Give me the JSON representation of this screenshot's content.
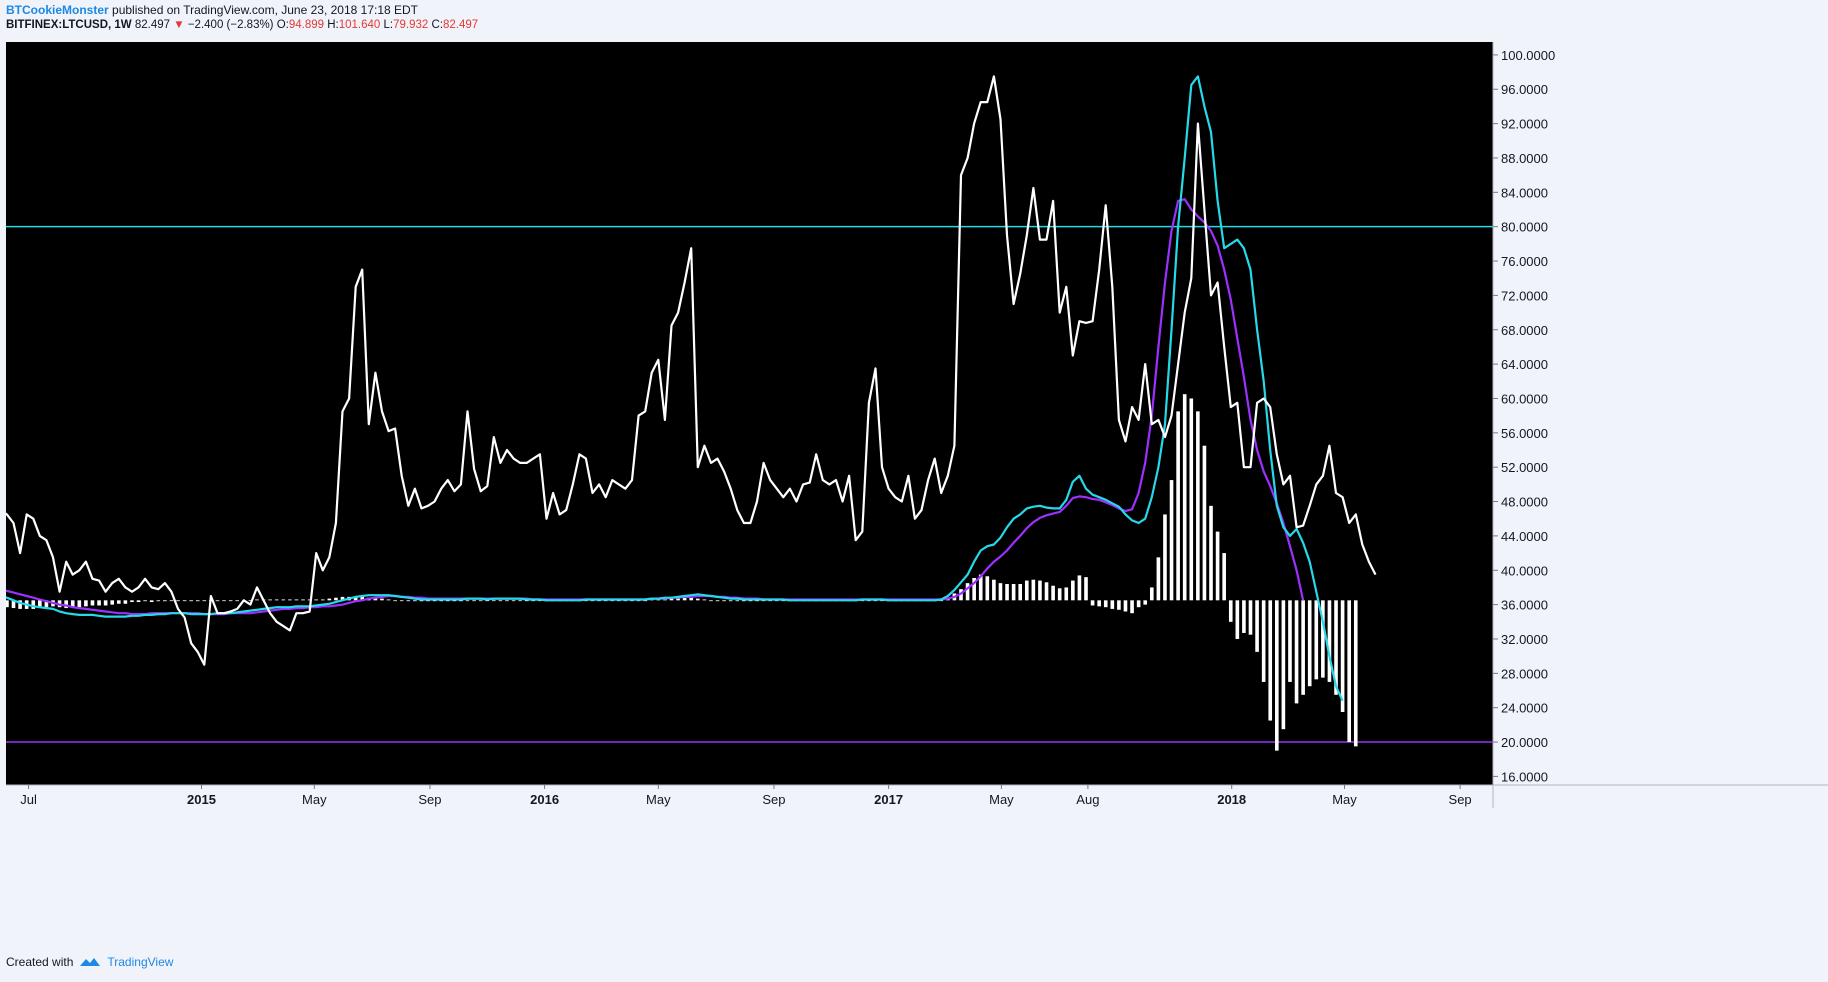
{
  "header": {
    "author": "BTCookieMonster",
    "published": "published on TradingView.com, June 23, 2018 17:18 EDT",
    "symbol": "BITFINEX:LTCUSD, 1W",
    "last": "82.497",
    "change": "−2.400 (−2.83%)",
    "o_label": "O:",
    "o": "94.899",
    "h_label": "H:",
    "h": "101.640",
    "l_label": "L:",
    "l": "79.932",
    "c_label": "C:",
    "c": "82.497",
    "down_arrow": "▼"
  },
  "footer": {
    "created": "Created with",
    "brand": "TradingView"
  },
  "colors": {
    "background": "#000000",
    "oscillator": "#ffffff",
    "fast_line": "#26d9e8",
    "slow_line": "#9b30ff",
    "upper_level": "#26d9e8",
    "lower_level": "#9b30ff",
    "histogram": "#ffffff",
    "axis_text": "#131722"
  },
  "chart_data": {
    "type": "line",
    "ylim": [
      15,
      101.5
    ],
    "xlim": [
      "2014-06-07",
      "2018-10-06"
    ],
    "y_ticks": [
      "100.0000",
      "96.0000",
      "92.0000",
      "88.0000",
      "84.0000",
      "80.0000",
      "76.0000",
      "72.0000",
      "68.0000",
      "64.0000",
      "60.0000",
      "56.0000",
      "52.0000",
      "48.0000",
      "44.0000",
      "40.0000",
      "36.0000",
      "32.0000",
      "28.0000",
      "24.0000",
      "20.0000",
      "16.0000"
    ],
    "x_ticks": [
      {
        "label": "Jul",
        "date": "2014-07-01",
        "bold": false
      },
      {
        "label": "2015",
        "date": "2015-01-01",
        "bold": true
      },
      {
        "label": "May",
        "date": "2015-05-01",
        "bold": false
      },
      {
        "label": "Sep",
        "date": "2015-09-01",
        "bold": false
      },
      {
        "label": "2016",
        "date": "2016-01-01",
        "bold": true
      },
      {
        "label": "May",
        "date": "2016-05-01",
        "bold": false
      },
      {
        "label": "Sep",
        "date": "2016-09-01",
        "bold": false
      },
      {
        "label": "2017",
        "date": "2017-01-01",
        "bold": true
      },
      {
        "label": "May",
        "date": "2017-05-01",
        "bold": false
      },
      {
        "label": "Aug",
        "date": "2017-08-01",
        "bold": false
      },
      {
        "label": "2018",
        "date": "2018-01-01",
        "bold": true
      },
      {
        "label": "May",
        "date": "2018-05-01",
        "bold": false
      },
      {
        "label": "Sep",
        "date": "2018-09-01",
        "bold": false
      }
    ],
    "horizontal_levels": [
      {
        "value": 80
      },
      {
        "value": 20
      }
    ],
    "histogram_baseline": 36.5,
    "series": [
      {
        "key": "oscillator",
        "start": "2014-06-01",
        "step_days": 7,
        "values": [
          47,
          46.5,
          45.5,
          42,
          46.5,
          46,
          44,
          43.5,
          41.5,
          37.5,
          41,
          39.5,
          40,
          41,
          39,
          38.8,
          37.5,
          38.5,
          39,
          38,
          37.5,
          38,
          39,
          38,
          37.8,
          38.5,
          37.5,
          35.5,
          34.5,
          31.5,
          30.5,
          29,
          37,
          35,
          35,
          35.2,
          35.5,
          36.5,
          36,
          38,
          36.5,
          35,
          34,
          33.5,
          33,
          35,
          35,
          35.2,
          42,
          40,
          41.5,
          45.5,
          58.5,
          60,
          73,
          75,
          57,
          63,
          58.5,
          56.2,
          56.5,
          51,
          47.5,
          49.5,
          47.2,
          47.5,
          48,
          49.5,
          50.5,
          49.2,
          50,
          58.5,
          51.8,
          49.2,
          49.8,
          55.5,
          52.5,
          54,
          53,
          52.5,
          52.5,
          53,
          53.5,
          46,
          49,
          46.5,
          47,
          50,
          53.5,
          53,
          49,
          50,
          48.5,
          50.5,
          50,
          49.5,
          50.5,
          58,
          58.5,
          63,
          64.5,
          57.5,
          68.5,
          70,
          73.5,
          77.5,
          52,
          54.5,
          52.5,
          53,
          51.5,
          49.5,
          47,
          45.5,
          45.5,
          48,
          52.5,
          50.5,
          49.5,
          48.5,
          49.5,
          48,
          50,
          50.2,
          53.5,
          50.5,
          50,
          50.5,
          48,
          51,
          43.5,
          44.5,
          59.5,
          63.5,
          52,
          49.5,
          48.5,
          48,
          51,
          46,
          47,
          50.5,
          53,
          49,
          51,
          54.5,
          86,
          88,
          92,
          94.5,
          94.5,
          97.5,
          92.5,
          79,
          71,
          74.5,
          79,
          84.5,
          78.5,
          78.5,
          83,
          70,
          73,
          65,
          69,
          68.8,
          69,
          75,
          82.5,
          73,
          57.5,
          55,
          59,
          57.5,
          64,
          57,
          57.5,
          55.5,
          58,
          64,
          70,
          74,
          92,
          82,
          72,
          73.5,
          66,
          59,
          59.5,
          52,
          52,
          59.5,
          60,
          59,
          53.5,
          50,
          51,
          45,
          45.2,
          47.5,
          50,
          51,
          54.5,
          49,
          48.5,
          45.5,
          46.5,
          43,
          41,
          39.5
        ]
      },
      {
        "key": "fast_line",
        "start": "2014-06-01",
        "step_days": 7,
        "values": [
          37,
          36.8,
          36.5,
          36.2,
          36,
          35.8,
          35.7,
          35.6,
          35.5,
          35.2,
          35,
          34.9,
          34.8,
          34.8,
          34.8,
          34.7,
          34.6,
          34.6,
          34.6,
          34.6,
          34.7,
          34.7,
          34.8,
          34.8,
          34.9,
          34.9,
          35,
          35,
          35,
          34.9,
          34.9,
          34.9,
          34.9,
          35,
          35,
          35,
          35.1,
          35.2,
          35.3,
          35.4,
          35.5,
          35.6,
          35.7,
          35.7,
          35.7,
          35.8,
          35.8,
          35.8,
          35.9,
          36,
          36.1,
          36.3,
          36.5,
          36.7,
          36.9,
          37,
          37.1,
          37.1,
          37.1,
          37.1,
          37,
          36.9,
          36.8,
          36.7,
          36.6,
          36.6,
          36.6,
          36.6,
          36.6,
          36.6,
          36.6,
          36.7,
          36.7,
          36.7,
          36.6,
          36.7,
          36.7,
          36.7,
          36.7,
          36.7,
          36.6,
          36.6,
          36.6,
          36.5,
          36.5,
          36.5,
          36.5,
          36.5,
          36.5,
          36.6,
          36.6,
          36.6,
          36.6,
          36.6,
          36.6,
          36.6,
          36.6,
          36.6,
          36.6,
          36.7,
          36.7,
          36.8,
          36.8,
          36.9,
          37,
          37.1,
          37.2,
          37.1,
          37,
          36.9,
          36.8,
          36.7,
          36.7,
          36.6,
          36.6,
          36.6,
          36.6,
          36.6,
          36.6,
          36.6,
          36.5,
          36.5,
          36.5,
          36.5,
          36.5,
          36.5,
          36.5,
          36.5,
          36.5,
          36.5,
          36.5,
          36.6,
          36.6,
          36.6,
          36.6,
          36.5,
          36.5,
          36.5,
          36.5,
          36.5,
          36.5,
          36.5,
          36.5,
          36.6,
          37,
          37.7,
          38.6,
          39.5,
          41,
          42.3,
          42.8,
          43,
          43.8,
          45,
          46,
          46.5,
          47.2,
          47.4,
          47.5,
          47.3,
          47.2,
          47.2,
          48.2,
          50.3,
          51,
          49.5,
          48.8,
          48.5,
          48.2,
          47.8,
          47.4,
          46.5,
          45.8,
          45.5,
          46,
          48.5,
          52,
          57,
          68,
          80,
          88,
          96.5,
          97.5,
          94,
          91,
          83,
          77.5,
          78,
          78.5,
          77.5,
          75,
          68,
          62,
          54,
          47.5,
          45,
          44,
          44.8,
          43.2,
          41,
          37.5,
          34,
          30,
          26.5,
          24.8
        ]
      },
      {
        "key": "slow_line",
        "start": "2014-06-01",
        "step_days": 7,
        "values": [
          37.8,
          37.6,
          37.4,
          37.2,
          37,
          36.8,
          36.6,
          36.4,
          36.2,
          36,
          35.9,
          35.7,
          35.6,
          35.5,
          35.4,
          35.3,
          35.2,
          35.1,
          35,
          35,
          34.9,
          34.9,
          34.9,
          35,
          35,
          35,
          35,
          35,
          35,
          35,
          35,
          34.9,
          34.9,
          34.9,
          34.9,
          35,
          35,
          35,
          35,
          35.1,
          35.2,
          35.3,
          35.4,
          35.5,
          35.5,
          35.6,
          35.6,
          35.7,
          35.7,
          35.8,
          35.8,
          35.9,
          36,
          36.2,
          36.4,
          36.5,
          36.7,
          36.8,
          36.9,
          37,
          37,
          36.9,
          36.9,
          36.8,
          36.8,
          36.7,
          36.7,
          36.7,
          36.7,
          36.7,
          36.7,
          36.7,
          36.7,
          36.7,
          36.7,
          36.7,
          36.7,
          36.7,
          36.7,
          36.7,
          36.7,
          36.6,
          36.6,
          36.6,
          36.6,
          36.6,
          36.6,
          36.6,
          36.6,
          36.6,
          36.6,
          36.6,
          36.6,
          36.6,
          36.6,
          36.6,
          36.6,
          36.6,
          36.6,
          36.7,
          36.7,
          36.7,
          36.8,
          36.8,
          36.9,
          36.9,
          37,
          37,
          37,
          36.9,
          36.9,
          36.8,
          36.8,
          36.7,
          36.7,
          36.7,
          36.6,
          36.6,
          36.6,
          36.6,
          36.6,
          36.6,
          36.6,
          36.6,
          36.6,
          36.6,
          36.6,
          36.6,
          36.6,
          36.6,
          36.6,
          36.6,
          36.6,
          36.6,
          36.6,
          36.6,
          36.6,
          36.6,
          36.6,
          36.6,
          36.6,
          36.6,
          36.6,
          36.6,
          36.7,
          36.9,
          37.3,
          37.9,
          38.5,
          39.3,
          40.2,
          41,
          41.6,
          42.3,
          43.2,
          44,
          44.9,
          45.6,
          46.1,
          46.4,
          46.6,
          46.8,
          47.5,
          48.4,
          48.6,
          48.5,
          48.3,
          48.2,
          47.9,
          47.6,
          47.2,
          46.9,
          47.1,
          49,
          52.5,
          58,
          66,
          73.5,
          79.5,
          83,
          83.2,
          82,
          81.2,
          80.5,
          79.5,
          77.8,
          75,
          71.5,
          67,
          62.5,
          57.5,
          54,
          51.5,
          49.8,
          47.8,
          45.5,
          42.8,
          40,
          36.5
        ]
      },
      {
        "key": "histogram",
        "start": "2014-06-01",
        "step_days": 7,
        "values": [
          -0.8,
          -0.8,
          -0.9,
          -1,
          -1,
          -1,
          -0.9,
          -0.8,
          -0.7,
          -0.8,
          -0.9,
          -0.8,
          -0.8,
          -0.7,
          -0.6,
          -0.6,
          -0.6,
          -0.5,
          -0.4,
          -0.4,
          -0.2,
          -0.2,
          -0.1,
          -0.2,
          -0.1,
          -0.1,
          0,
          0,
          0,
          -0.1,
          -0.1,
          0,
          0,
          0,
          0,
          0,
          0,
          0,
          0,
          0.1,
          0.1,
          0.1,
          0.1,
          0.1,
          0.1,
          0.1,
          0.1,
          0.1,
          0.1,
          0.1,
          0.2,
          0.3,
          0.4,
          0.4,
          0.4,
          0.4,
          0.3,
          0.3,
          0.2,
          0.1,
          0,
          0,
          -0.1,
          -0.1,
          -0.1,
          -0.1,
          -0.1,
          -0.1,
          -0.1,
          -0.1,
          -0.1,
          0,
          0,
          0,
          0,
          0,
          0,
          0,
          0,
          0,
          0,
          0,
          0,
          -0.1,
          -0.1,
          -0.1,
          -0.1,
          -0.1,
          -0.1,
          0,
          0,
          0,
          0,
          0,
          0,
          0,
          0,
          0,
          0,
          0.1,
          0.1,
          0.2,
          0.2,
          0.3,
          0.3,
          0.3,
          0.2,
          0.1,
          0,
          -0.1,
          -0.1,
          -0.1,
          -0.1,
          -0.1,
          -0.1,
          -0.1,
          0,
          0,
          0,
          0,
          -0.1,
          -0.1,
          -0.1,
          -0.1,
          -0.1,
          -0.1,
          -0.1,
          -0.1,
          -0.1,
          -0.1,
          -0.1,
          0,
          0,
          0,
          0,
          -0.1,
          -0.1,
          -0.1,
          -0.1,
          -0.1,
          -0.1,
          -0.1,
          -0.1,
          0,
          0.3,
          0.8,
          1.3,
          2,
          2.6,
          3,
          2.8,
          2.4,
          2,
          1.9,
          1.9,
          1.9,
          2.3,
          2.4,
          2.3,
          2.1,
          1.7,
          1.4,
          1.5,
          2.3,
          2.9,
          2.7,
          -0.6,
          -0.7,
          -0.8,
          -1,
          -1.1,
          -1.3,
          -1.5,
          -0.8,
          -0.5,
          1.5,
          5,
          10,
          14,
          22,
          24,
          23.5,
          22,
          18,
          11,
          8,
          5.5,
          -2.5,
          -4.5,
          -3.8,
          -4,
          -6,
          -9.5,
          -14,
          -17.5,
          -15,
          -9.5,
          -12,
          -11,
          -10,
          -9.2,
          -9,
          -9.5,
          -11,
          -13,
          -16.5,
          -17
        ]
      }
    ]
  }
}
